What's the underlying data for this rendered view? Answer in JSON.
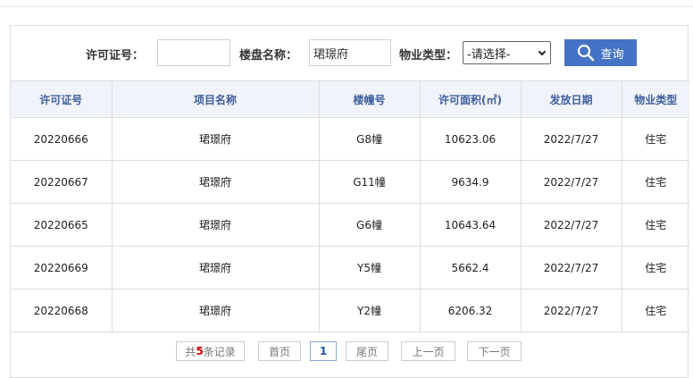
{
  "search": {
    "permit_label": "许可证号：",
    "permit_value": "",
    "project_label": "楼盘名称：",
    "project_value": "珺璟府",
    "type_label": "物业类型：",
    "type_selected": "-请选择-",
    "query_label": "查询"
  },
  "table": {
    "headers": [
      "许可证号",
      "项目名称",
      "楼幢号",
      "许可面积(㎡)",
      "发放日期",
      "物业类型"
    ],
    "rows": [
      [
        "20220666",
        "珺璟府",
        "G8幢",
        "10623.06",
        "2022/7/27",
        "住宅"
      ],
      [
        "20220667",
        "珺璟府",
        "G11幢",
        "9634.9",
        "2022/7/27",
        "住宅"
      ],
      [
        "20220665",
        "珺璟府",
        "G6幢",
        "10643.64",
        "2022/7/27",
        "住宅"
      ],
      [
        "20220669",
        "珺璟府",
        "Y5幢",
        "5662.4",
        "2022/7/27",
        "住宅"
      ],
      [
        "20220668",
        "珺璟府",
        "Y2幢",
        "6206.32",
        "2022/7/27",
        "住宅"
      ]
    ]
  },
  "pager": {
    "total_prefix": "共",
    "total_count": "5",
    "total_suffix": "条记录",
    "first": "首页",
    "current": "1",
    "last": "尾页",
    "prev": "上一页",
    "next": "下一页"
  }
}
